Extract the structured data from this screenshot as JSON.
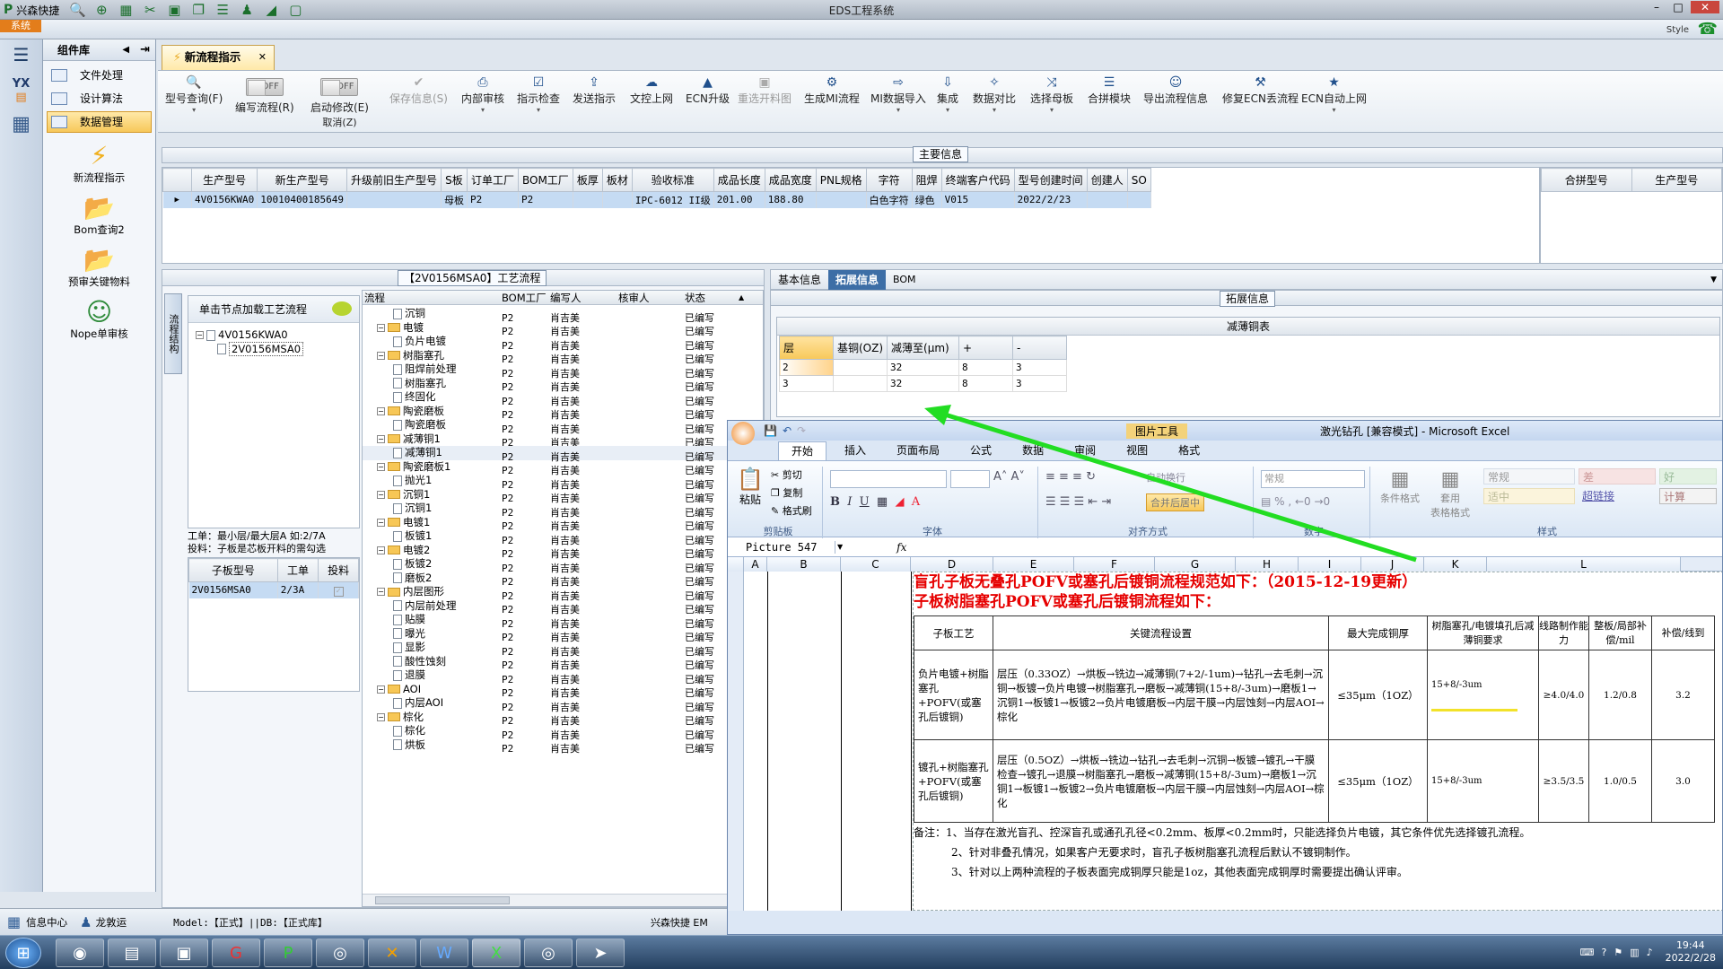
{
  "app": {
    "title": "EDS工程系统",
    "brand": "兴森快捷",
    "sys_tab": "系统",
    "style_label": "Style"
  },
  "sidebar": {
    "header": "组件库",
    "items": [
      {
        "label": "文件处理"
      },
      {
        "label": "设计算法"
      },
      {
        "label": "数据管理"
      }
    ],
    "big": [
      {
        "label": "新流程指示"
      },
      {
        "label": "Bom查询2"
      },
      {
        "label": "预审关键物料"
      },
      {
        "label": "Nope单审核"
      }
    ]
  },
  "doc_tab": {
    "label": "新流程指示"
  },
  "ribbon": {
    "items": [
      "型号查询(F)",
      "编写流程(R)",
      "启动修改(E)",
      "保存信息(S)",
      "内部审核",
      "指示检查",
      "发送指示",
      "文控上网",
      "ECN升级",
      "重选开料图",
      "生成MI流程",
      "MI数据导入",
      "集成",
      "数据对比",
      "选择母板",
      "合拼模块",
      "导出流程信息",
      "修复ECN丢流程",
      "ECN自动上网"
    ],
    "cancel": "取消(Z)",
    "toggle1": "OFF",
    "toggle2": "OFF"
  },
  "main_info": {
    "title": "主要信息",
    "headers": [
      "生产型号",
      "新生产型号",
      "升级前旧生产型号",
      "S板",
      "订单工厂",
      "BOM工厂",
      "板厚",
      "板材",
      "验收标准",
      "成品长度",
      "成品宽度",
      "PNL规格",
      "字符",
      "阻焊",
      "终端客户代码",
      "型号创建时间",
      "创建人",
      "SO"
    ],
    "row": [
      "4V0156KWA0",
      "10010400185649",
      "",
      "母板",
      "P2",
      "P2",
      "",
      "",
      "IPC-6012 II级",
      "201.00",
      "188.80",
      "",
      "白色字符",
      "绿色",
      "V015",
      "2022/2/23",
      "",
      ""
    ],
    "right_headers": [
      "合拼型号",
      "生产型号"
    ]
  },
  "process": {
    "title": "【2V0156MSA0】工艺流程",
    "side_tab": "流程结构",
    "hint": "单击节点加载工艺流程",
    "tree": [
      "4V0156KWA0",
      "2V0156MSA0"
    ],
    "note": "工单：最小层/最大层A 如:2/7A\n投料：子板是芯板开料的需勾选",
    "sub_headers": [
      "子板型号",
      "工单",
      "投料"
    ],
    "sub_row": [
      "2V0156MSA0",
      "2/3A",
      ""
    ],
    "headers": [
      "流程",
      "BOM工厂",
      "编写人",
      "核审人",
      "状态"
    ],
    "rows": [
      [
        "沉铜",
        1
      ],
      [
        "电镀",
        0
      ],
      [
        "负片电镀",
        1
      ],
      [
        "树脂塞孔",
        0
      ],
      [
        "阻焊前处理",
        1
      ],
      [
        "树脂塞孔",
        1
      ],
      [
        "终固化",
        1
      ],
      [
        "陶瓷磨板",
        0
      ],
      [
        "陶瓷磨板",
        1
      ],
      [
        "减薄铜1",
        0
      ],
      [
        "减薄铜1",
        1
      ],
      [
        "陶瓷磨板1",
        0
      ],
      [
        "抛光1",
        1
      ],
      [
        "沉铜1",
        0
      ],
      [
        "沉铜1",
        1
      ],
      [
        "电镀1",
        0
      ],
      [
        "板镀1",
        1
      ],
      [
        "电镀2",
        0
      ],
      [
        "板镀2",
        1
      ],
      [
        "磨板2",
        1
      ],
      [
        "内层图形",
        0
      ],
      [
        "内层前处理",
        1
      ],
      [
        "贴膜",
        1
      ],
      [
        "曝光",
        1
      ],
      [
        "显影",
        1
      ],
      [
        "酸性蚀刻",
        1
      ],
      [
        "退膜",
        1
      ],
      [
        "AOI",
        0
      ],
      [
        "内层AOI",
        1
      ],
      [
        "棕化",
        0
      ],
      [
        "棕化",
        1
      ],
      [
        "烘板",
        1
      ]
    ],
    "factory": "P2",
    "writer": "肖吉美",
    "status": "已编写"
  },
  "ext": {
    "tabs": [
      "基本信息",
      "拓展信息",
      "BOM"
    ],
    "section": "拓展信息",
    "table_title": "减薄铜表",
    "headers": [
      "层",
      "基铜(OZ)",
      "减薄至(μm)",
      "+",
      "-"
    ],
    "rows": [
      [
        "2",
        "",
        "32",
        "8",
        "3"
      ],
      [
        "3",
        "",
        "32",
        "8",
        "3"
      ]
    ]
  },
  "excel": {
    "title": "激光钻孔 [兼容模式] - Microsoft Excel",
    "picture_tools": "图片工具",
    "tabs": [
      "开始",
      "插入",
      "页面布局",
      "公式",
      "数据",
      "审阅",
      "视图",
      "格式"
    ],
    "clip": [
      "剪切",
      "复制",
      "格式刷"
    ],
    "paste": "粘贴",
    "groups": [
      "剪贴板",
      "字体",
      "对齐方式",
      "数字",
      "样式"
    ],
    "number_format": "常规",
    "merge": "合并后居中",
    "wrap": "自动换行",
    "cond": "条件格式",
    "table_fmt": "套用\n表格格式",
    "styles": [
      "常规",
      "差",
      "好",
      "适中",
      "超链接",
      "计算"
    ],
    "namebox": "Picture 547",
    "fx": "fx",
    "cols": [
      "A",
      "B",
      "C",
      "D",
      "E",
      "F",
      "G",
      "H",
      "I",
      "J",
      "K",
      "L"
    ],
    "doc_title1": "盲孔子板无叠孔POFV或塞孔后镀铜流程规范如下：（2015-12-19更新）",
    "doc_title2": "子板树脂塞孔POFV或塞孔后镀铜流程如下：",
    "table_headers": [
      "子板工艺",
      "关键流程设置",
      "最大完成铜厚",
      "树脂塞孔/电镀填孔后减薄铜要求",
      "线路制作能力",
      "整板/局部补偿/mil",
      "补偿/线到"
    ],
    "rows": [
      [
        "负片电镀+树脂塞孔+POFV(或塞孔后镀铜)",
        "层压（0.33OZ）→烘板→铣边→减薄铜(7+2/-1um)→钻孔→去毛刺→沉铜→板镀→负片电镀→树脂塞孔→磨板→减薄铜(15+8/-3um)→磨板1→沉铜1→板镀1→板镀2→负片电镀磨板→内层干膜→内层蚀刻→内层AOI→棕化",
        "≤35μm（1OZ）",
        "15+8/-3um",
        "≥4.0/4.0",
        "1.2/0.8",
        "3.2"
      ],
      [
        "镀孔+树脂塞孔+POFV(或塞孔后镀铜)",
        "层压（0.5OZ）→烘板→铣边→钻孔→去毛刺→沉铜→板镀→镀孔→干膜检查→镀孔→退膜→树脂塞孔→磨板→减薄铜(15+8/-3um)→磨板1→沉铜1→板镀1→板镀2→负片电镀磨板→内层干膜→内层蚀刻→内层AOI→棕化",
        "≤35μm（1OZ）",
        "15+8/-3um",
        "≥3.5/3.5",
        "1.0/0.5",
        "3.0"
      ]
    ],
    "notes": [
      "备注：1、当存在激光盲孔、控深盲孔或通孔孔径<0.2mm、板厚<0.2mm时，只能选择负片电镀，其它条件优先选择镀孔流程。",
      "2、针对非叠孔情况，如果客户无要求时，盲孔子板树脂塞孔流程后默认不镀铜制作。",
      "3、针对以上两种流程的子板表面完成铜厚只能是1oz，其他表面完成铜厚时需要提出确认评审。"
    ]
  },
  "status": {
    "info": "信息中心",
    "user": "龙敦运",
    "model": "Model:【正式】||DB:【正式库】",
    "brand": "兴森快捷 EM"
  },
  "taskbar": {
    "time": "19:44",
    "date": "2022/2/28"
  },
  "colors": {
    "accent": "#f7c85a",
    "excel_red": "#e60000",
    "arrow": "#22dd22"
  }
}
